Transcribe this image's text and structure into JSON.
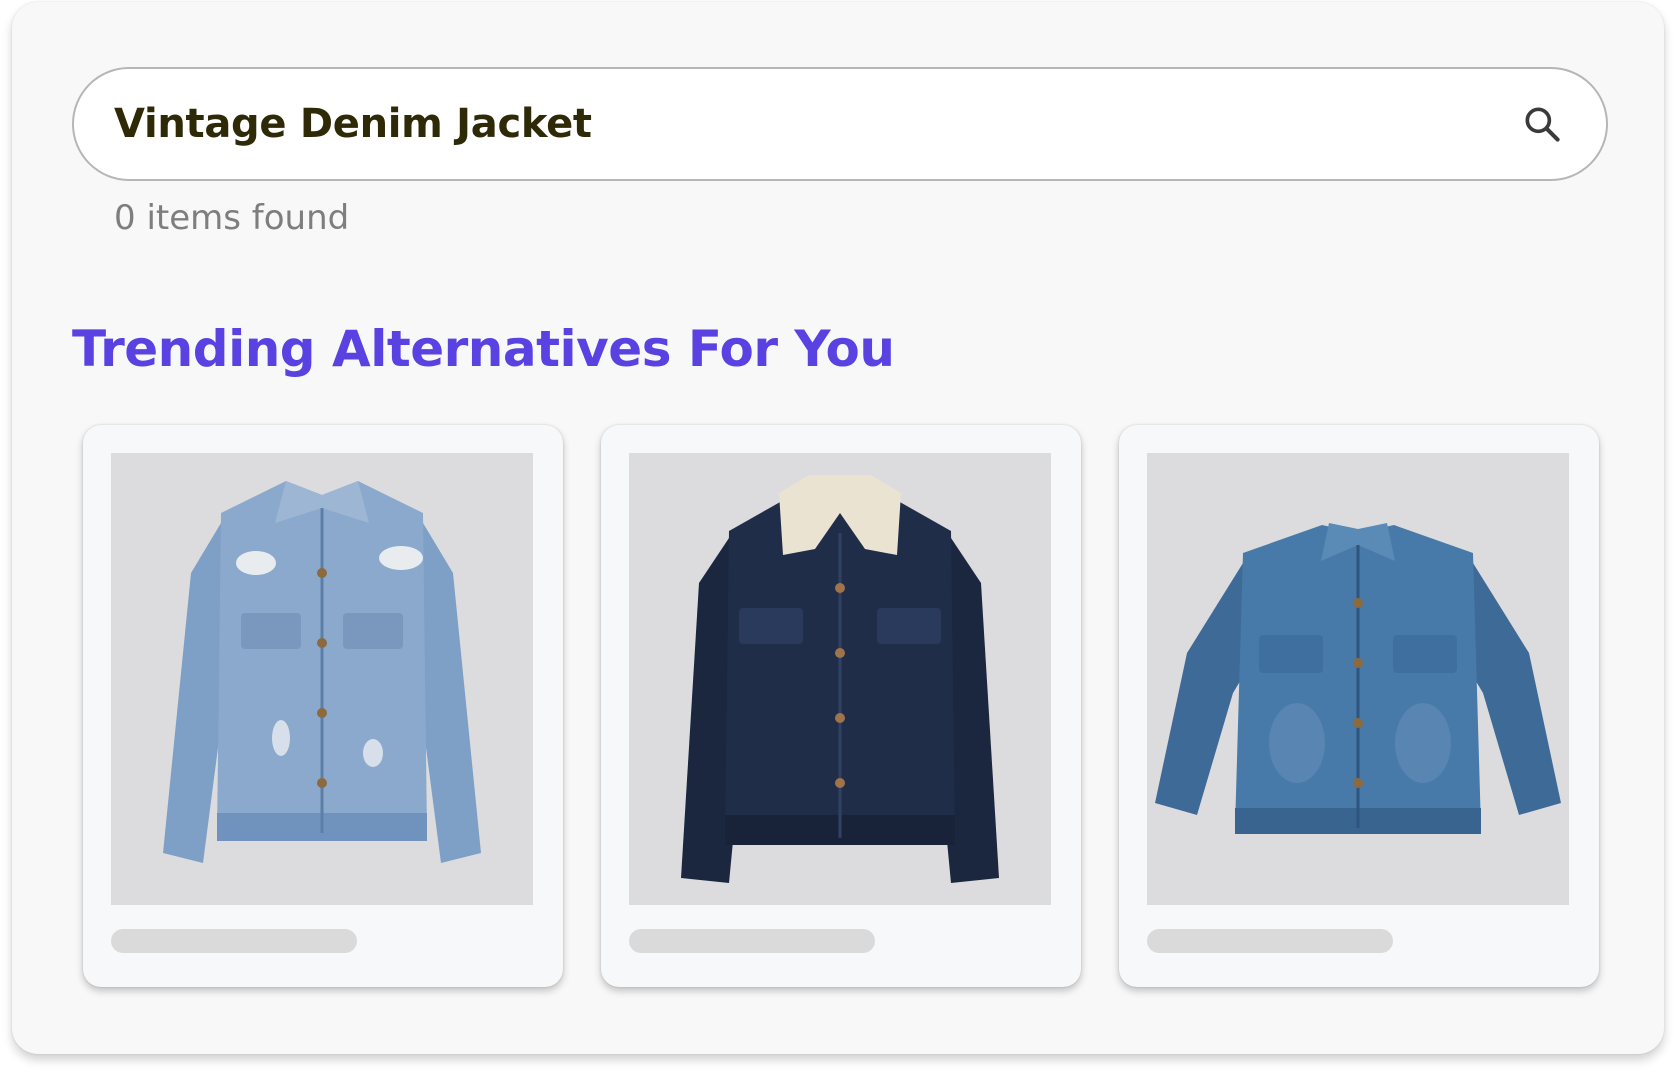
{
  "search": {
    "query": "Vintage Denim Jacket",
    "icon": "search-icon",
    "results_text": "0 items found"
  },
  "recommendations": {
    "title": "Trending Alternatives For You",
    "title_color": "#5a41e2",
    "products": [
      {
        "image": "distressed light-wash denim jacket",
        "color": "#6f93bd"
      },
      {
        "image": "dark denim jacket with sherpa collar",
        "color": "#1d2a44"
      },
      {
        "image": "medium-wash oversized denim jacket",
        "color": "#416e9c"
      }
    ]
  }
}
